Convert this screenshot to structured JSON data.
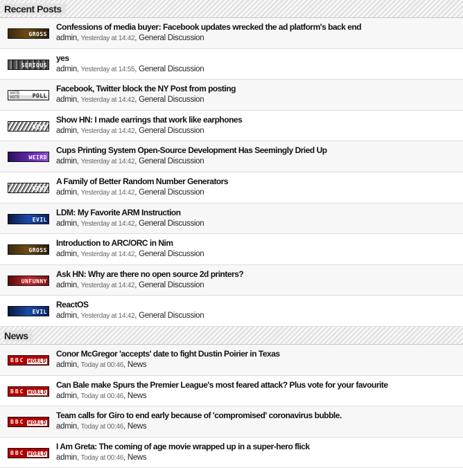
{
  "recent": {
    "heading": "Recent Posts",
    "posts": [
      {
        "title": "Confessions of media buyer: Facebook updates wrecked the ad platform's back end",
        "author": "admin",
        "time": "Yesterday at 14:42",
        "forum": "General Discussion",
        "tag": "gross",
        "style": "av-gross"
      },
      {
        "title": "yes",
        "author": "admin",
        "time": "Yesterday at 14:55",
        "forum": "General Discussion",
        "tag": "serious",
        "style": "av-serious"
      },
      {
        "title": "Facebook, Twitter block the NY Post from posting",
        "author": "admin",
        "time": "Yesterday at 14:42",
        "forum": "General Discussion",
        "tag": "poll",
        "style": "av-poll"
      },
      {
        "title": "Show HN: I made earrings that work like earphones",
        "author": "admin",
        "time": "Yesterday at 14:42",
        "forum": "General Discussion",
        "tag": "news",
        "style": "av-news"
      },
      {
        "title": "Cups Printing System Open-Source Development Has Seemingly Dried Up",
        "author": "admin",
        "time": "Yesterday at 14:42",
        "forum": "General Discussion",
        "tag": "weird",
        "style": "av-weird"
      },
      {
        "title": "A Family of Better Random Number Generators",
        "author": "admin",
        "time": "Yesterday at 14:42",
        "forum": "General Discussion",
        "tag": "news",
        "style": "av-news"
      },
      {
        "title": "LDM: My Favorite ARM Instruction",
        "author": "admin",
        "time": "Yesterday at 14:42",
        "forum": "General Discussion",
        "tag": "evil",
        "style": "av-eval"
      },
      {
        "title": "Introduction to ARC/ORC in Nim",
        "author": "admin",
        "time": "Yesterday at 14:42",
        "forum": "General Discussion",
        "tag": "gross",
        "style": "av-gross"
      },
      {
        "title": "Ask HN: Why are there no open source 2d printers?",
        "author": "admin",
        "time": "Yesterday at 14:42",
        "forum": "General Discussion",
        "tag": "unfunny",
        "style": "av-unfunny"
      },
      {
        "title": "ReactOS",
        "author": "admin",
        "time": "Yesterday at 14:42",
        "forum": "General Discussion",
        "tag": "evil",
        "style": "av-eval"
      }
    ]
  },
  "news": {
    "heading": "News",
    "posts": [
      {
        "title": "Conor McGregor 'accepts' date to fight Dustin Poirier in Texas",
        "author": "admin",
        "time": "Today at 00:46",
        "forum": "News",
        "tag": "world",
        "style": "av-bbc"
      },
      {
        "title": "Can Bale make Spurs the Premier League's most feared attack? Plus vote for your favourite",
        "author": "admin",
        "time": "Today at 00:46",
        "forum": "News",
        "tag": "world",
        "style": "av-bbc"
      },
      {
        "title": "Team calls for Giro to end early because of 'compromised' coronavirus bubble.",
        "author": "admin",
        "time": "Today at 00:46",
        "forum": "News",
        "tag": "world",
        "style": "av-bbc"
      },
      {
        "title": "I Am Greta: The coming of age movie wrapped up in a super-hero flick",
        "author": "admin",
        "time": "Today at 00:46",
        "forum": "News",
        "tag": "world",
        "style": "av-bbc"
      }
    ]
  },
  "avatar_text": {
    "bbc": "BBC",
    "vote": "VOTE"
  },
  "separators": {
    "comma": ", "
  }
}
